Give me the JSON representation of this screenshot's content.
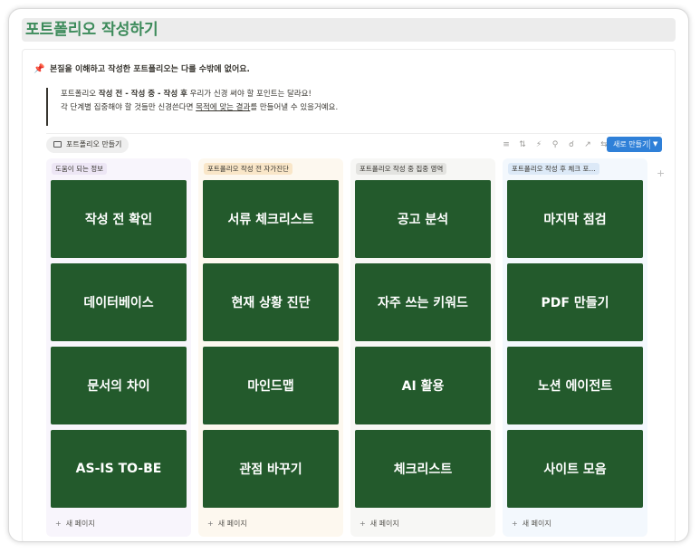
{
  "page": {
    "title": "포트폴리오 작성하기"
  },
  "callout": {
    "icon": "pushpin-icon",
    "heading": "본질을 이해하고 작성한 포트폴리오는 다를 수밖에 없어요."
  },
  "quote": {
    "line1_a": "포트폴리오 ",
    "line1_b": "작성 전 - 작성 중 - 작성 후",
    "line1_c": " 우리가 신경 써야 할 포인트는 달라요!",
    "line2_a": "각 단계별 집중해야 할 것들만 신경쓴다면 ",
    "line2_b": "목적에 맞는 결과",
    "line2_c": "를 만들어낼 수 있을거예요."
  },
  "view": {
    "tab_label": "포트폴리오 만들기",
    "new_button": "새로 만들기"
  },
  "toolbar_icons": [
    "filter-icon",
    "sort-icon",
    "lightning-icon",
    "search-icon",
    "zoom-icon",
    "expand-icon",
    "settings-icon"
  ],
  "columns": [
    {
      "header": "도움이 되는 정보",
      "header_bg": "#ede6f5",
      "col_bg": "#f8f5fc",
      "cards": [
        "작성 전 확인",
        "데이터베이스",
        "문서의 차이",
        "AS-IS TO-BE"
      ],
      "new_page": "새 페이지"
    },
    {
      "header": "포트폴리오 작성 전 자가진단",
      "header_bg": "#f9e6c8",
      "col_bg": "#fdf8ef",
      "cards": [
        "서류 체크리스트",
        "현재 상황 진단",
        "마인드맵",
        "관점 바꾸기"
      ],
      "new_page": "새 페이지"
    },
    {
      "header": "포트폴리오 작성 중 집중 영역",
      "header_bg": "#e3e3e0",
      "col_bg": "#f7f7f5",
      "cards": [
        "공고 분석",
        "자주 쓰는 키워드",
        "AI 활용",
        "체크리스트"
      ],
      "new_page": "새 페이지"
    },
    {
      "header": "포트폴리오 작성 후 체크 포...",
      "header_bg": "#dce9f7",
      "col_bg": "#f3f8fd",
      "cards": [
        "마지막 점검",
        "PDF 만들기",
        "노션 에이전트",
        "사이트 모음"
      ],
      "new_page": "새 페이지"
    }
  ],
  "add_column": "+"
}
